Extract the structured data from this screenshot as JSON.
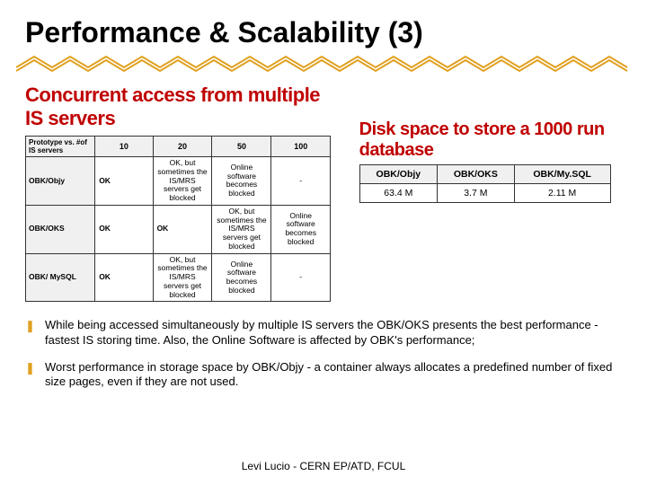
{
  "title": "Performance & Scalability (3)",
  "subhead1": "Concurrent access from multiple IS servers",
  "subhead2": "Disk space to store a 1000 run database",
  "table1": {
    "corner": "Prototype vs. #of IS servers",
    "cols": [
      "10",
      "20",
      "50",
      "100"
    ],
    "rows": [
      {
        "name": "OBK/Objy",
        "cells": [
          "OK",
          "OK, but sometimes the IS/MRS servers get blocked",
          "Online software becomes blocked",
          "-"
        ]
      },
      {
        "name": "OBK/OKS",
        "cells": [
          "OK",
          "OK",
          "OK, but sometimes the IS/MRS servers get blocked",
          "Online software becomes blocked"
        ]
      },
      {
        "name": "OBK/ MySQL",
        "cells": [
          "OK",
          "OK, but sometimes the IS/MRS servers get blocked",
          "Online software becomes blocked",
          "-"
        ]
      }
    ]
  },
  "table2": {
    "cols": [
      "OBK/Objy",
      "OBK/OKS",
      "OBK/My.SQL"
    ],
    "vals": [
      "63.4 M",
      "3.7 M",
      "2.11 M"
    ]
  },
  "bullets": [
    "While being accessed simultaneously by multiple IS servers the OBK/OKS presents the best performance - fastest IS storing time. Also, the Online Software is affected by OBK's performance;",
    "Worst performance in storage space by OBK/Objy - a container always allocates a predefined number of fixed size pages, even if they are not used."
  ],
  "footer": "Levi Lucio - CERN EP/ATD, FCUL"
}
